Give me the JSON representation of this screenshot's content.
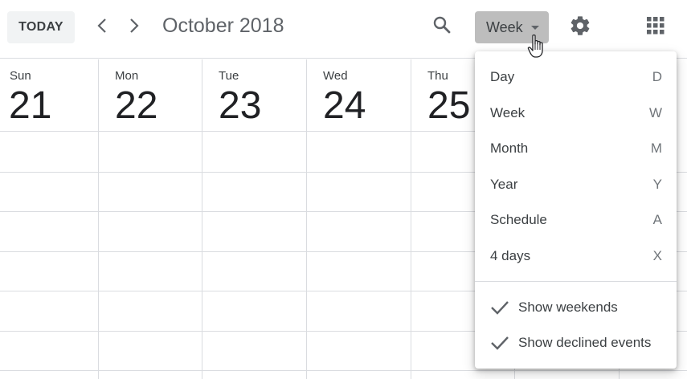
{
  "toolbar": {
    "today_label": "TODAY",
    "month_title": "October 2018",
    "view_label": "Week"
  },
  "icons": {
    "prev": "chevron-left-icon",
    "next": "chevron-right-icon",
    "search": "search-icon",
    "settings": "gear-icon",
    "apps": "apps-grid-icon",
    "view_dropdown": "caret-down-icon",
    "cursor": "hand-pointer-icon",
    "check": "checkmark-icon"
  },
  "days": [
    {
      "dow": "Sun",
      "num": "21"
    },
    {
      "dow": "Mon",
      "num": "22"
    },
    {
      "dow": "Tue",
      "num": "23"
    },
    {
      "dow": "Wed",
      "num": "24"
    },
    {
      "dow": "Thu",
      "num": "25"
    }
  ],
  "view_menu": {
    "items": [
      {
        "label": "Day",
        "key": "D"
      },
      {
        "label": "Week",
        "key": "W"
      },
      {
        "label": "Month",
        "key": "M"
      },
      {
        "label": "Year",
        "key": "Y"
      },
      {
        "label": "Schedule",
        "key": "A"
      },
      {
        "label": "4 days",
        "key": "X"
      }
    ],
    "options": [
      {
        "label": "Show weekends",
        "checked": true
      },
      {
        "label": "Show declined events",
        "checked": true
      }
    ]
  },
  "colors": {
    "border": "#dadce0",
    "view_button_bg": "#bdbdbd",
    "today_button_bg": "#f1f3f4",
    "text": "#3c4043",
    "icon": "#5f6368"
  }
}
